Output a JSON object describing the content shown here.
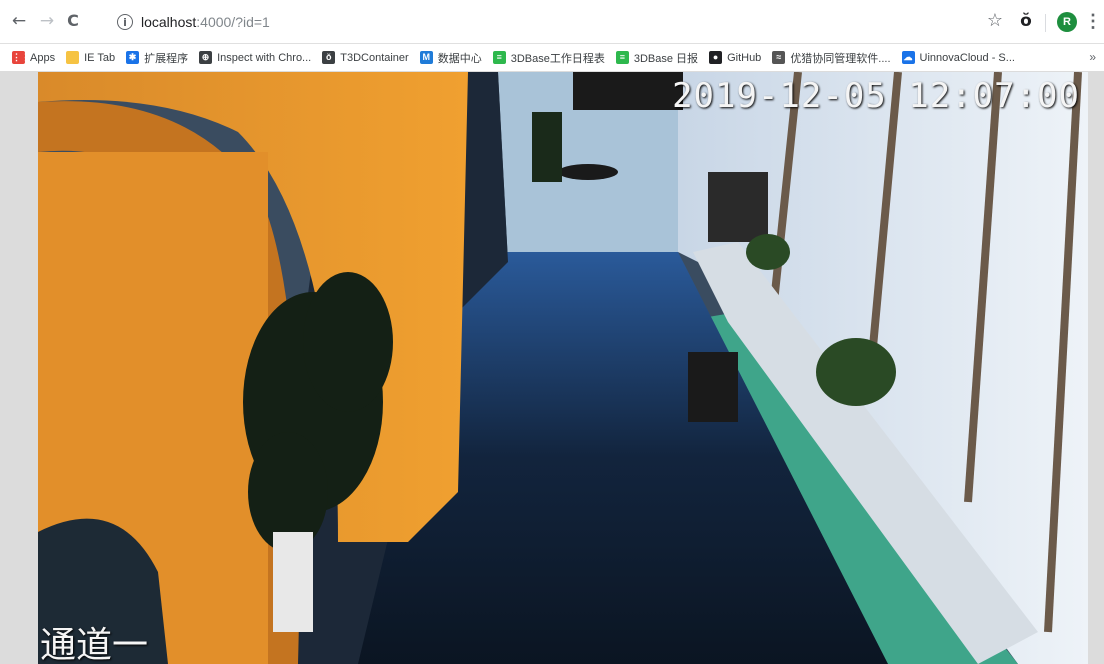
{
  "browser": {
    "nav": {
      "back_glyph": "←",
      "forward_glyph": "→",
      "reload_glyph": "C"
    },
    "address": {
      "host": "localhost",
      "path": ":4000/?id=1",
      "info_glyph": "i"
    },
    "actions": {
      "star_glyph": "☆",
      "extension_glyph": "ŏ",
      "avatar_letter": "R",
      "menu_glyph": "⋮"
    },
    "bookmarks": [
      {
        "label": "Apps",
        "icon": "apps-grid-icon",
        "color": "#e8453c"
      },
      {
        "label": "IE Tab",
        "icon": "folder-icon",
        "color": "#f6c343"
      },
      {
        "label": "扩展程序",
        "icon": "puzzle-icon",
        "color": "#1a73e8"
      },
      {
        "label": "Inspect with Chro...",
        "icon": "globe-icon",
        "color": "#3c4043"
      },
      {
        "label": "T3DContainer",
        "icon": "t3d-icon",
        "color": "#3c4043"
      },
      {
        "label": "数据中心",
        "icon": "chart-app-icon",
        "color": "#1f7bd8"
      },
      {
        "label": "3DBase工作日程表",
        "icon": "sheet-icon",
        "color": "#2eb84d"
      },
      {
        "label": "3DBase 日报",
        "icon": "sheet-icon",
        "color": "#2eb84d"
      },
      {
        "label": "GitHub",
        "icon": "github-icon",
        "color": "#202124"
      },
      {
        "label": "优猎协同管理软件....",
        "icon": "app-icon",
        "color": "#555555"
      },
      {
        "label": "UinnovaCloud - S...",
        "icon": "cloud-app-icon",
        "color": "#1a73e8"
      }
    ],
    "bookmarks_more": "»"
  },
  "video": {
    "timestamp": "2019-12-05 12:07:00",
    "channel_label": "通道一"
  }
}
